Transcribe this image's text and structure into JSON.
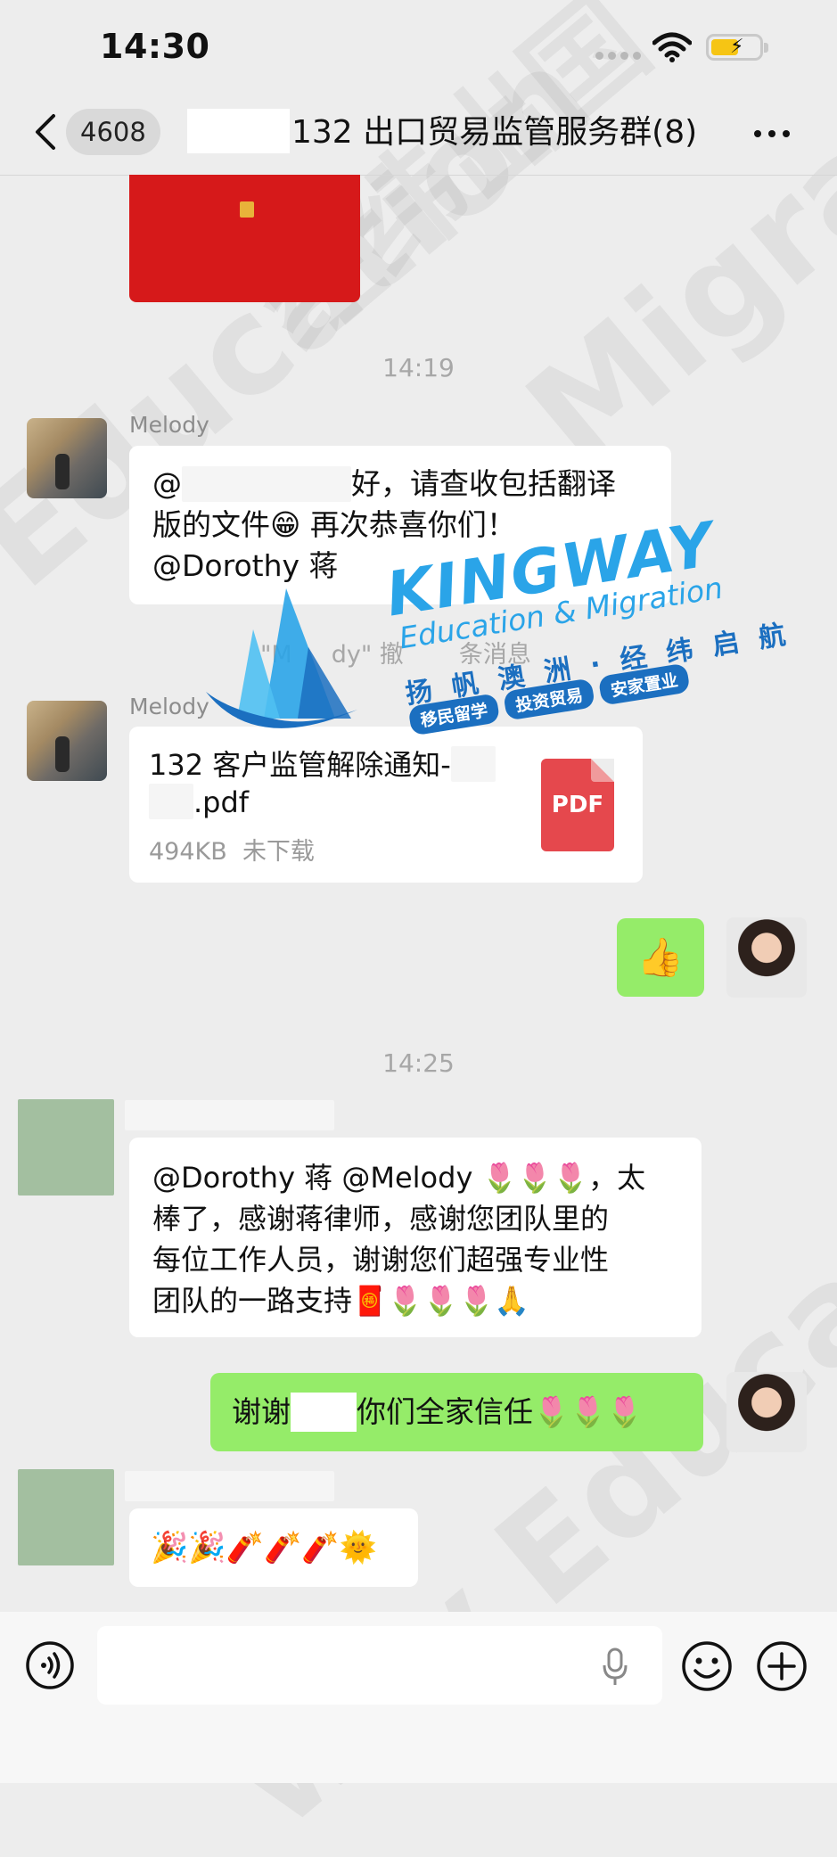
{
  "status_bar": {
    "time": "14:30"
  },
  "header": {
    "unread_count": "4608",
    "title": "132 出口贸易监管服务群(8)"
  },
  "messages": {
    "time_1": "14:19",
    "time_2": "14:25",
    "m1_sender": "Melody",
    "m1_line1_prefix": "@",
    "m1_line1_suffix": "好，请查收包括翻译",
    "m1_line2": "版的文件😁 再次恭喜你们！",
    "m1_line3": "@Dorothy 蒋",
    "recall_prefix": "\"M",
    "recall_middle": "dy\" 撤",
    "recall_suffix": "条消息",
    "m2_sender": "Melody",
    "file_name_line1": "132 客户监管解除通知-",
    "file_name_line2_suffix": ".pdf",
    "file_size": "494KB",
    "file_status": "未下载",
    "file_type": "PDF",
    "m3_text": "👍",
    "m4_line1": "@Dorothy 蒋 @Melody 🌷🌷🌷，太",
    "m4_line2": "棒了，感谢蒋律师，感谢您团队里的",
    "m4_line3": "每位工作人员，谢谢您们超强专业性",
    "m4_line4": "团队的一路支持🧧🌷🌷🌷🙏",
    "m5_prefix": "谢谢",
    "m5_suffix": "你们全家信任🌷🌷🌷",
    "m6_text": "🎉🎉🧨🧨🧨🌞"
  },
  "watermark": {
    "brand": "KINGWAY",
    "subtitle": "Education & Migration",
    "slogan": "扬 帆 澳 洲 · 经 纬 启 航",
    "tags": [
      "移民留学",
      "投资贸易",
      "安家置业"
    ],
    "diagonal_1": "Education",
    "diagonal_2": "Migration",
    "diagonal_3": "way Education",
    "diagonal_4": "经纬出国"
  },
  "colors": {
    "chat_background": "#ededed",
    "outgoing_bubble": "#95ec69",
    "incoming_bubble": "#ffffff",
    "pdf_red": "#e5484d",
    "brand_blue": "#2aa4e8"
  },
  "icons": {
    "back": "chevron-left-icon",
    "more": "more-icon",
    "voice": "voice-icon",
    "mic": "microphone-icon",
    "emoji": "emoji-icon",
    "plus": "plus-icon"
  }
}
